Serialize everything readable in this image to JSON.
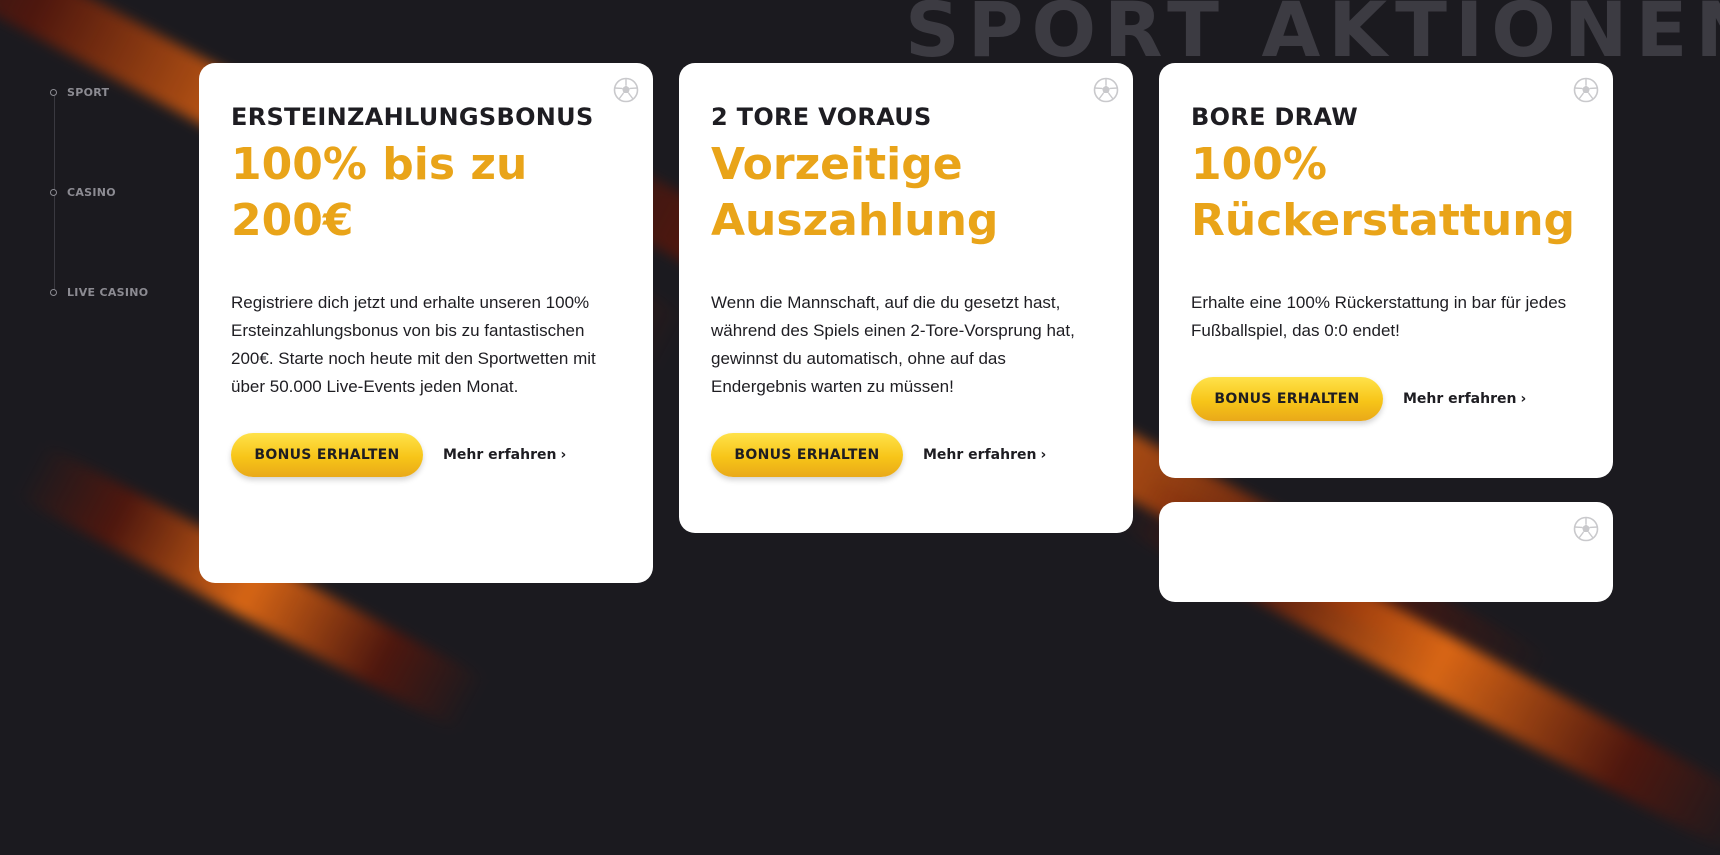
{
  "section_title": "SPORT AKTIONEN",
  "side_nav": {
    "items": [
      {
        "label": "SPORT"
      },
      {
        "label": "CASINO"
      },
      {
        "label": "LIVE CASINO"
      }
    ]
  },
  "cards": [
    {
      "kicker": "ERSTEINZAHLUNGSBONUS",
      "headline_line1": "100% bis zu",
      "headline_line2": "200€",
      "text": "Registriere dich jetzt und erhalte unseren 100% Ersteinzahlungsbonus von bis zu fantastischen 200€. Starte noch heute mit den Sportwetten mit über 50.000 Live-Events jeden Monat.",
      "button_label": "BONUS ERHALTEN",
      "link_label": "Mehr erfahren"
    },
    {
      "kicker": "2 TORE VORAUS",
      "headline_line1": "Vorzeitige",
      "headline_line2": "Auszahlung",
      "text": "Wenn die Mannschaft, auf die du gesetzt hast, während des Spiels einen 2-Tore-Vorsprung hat, gewinnst du automatisch, ohne auf das Endergebnis warten zu müssen!",
      "button_label": "BONUS ERHALTEN",
      "link_label": "Mehr erfahren"
    },
    {
      "kicker": "BORE DRAW",
      "headline_line1": "100%",
      "headline_line2": "Rückerstattung",
      "text": "Erhalte eine 100% Rückerstattung in bar für jedes Fußballspiel, das 0:0 endet!",
      "button_label": "BONUS ERHALTEN",
      "link_label": "Mehr erfahren"
    }
  ],
  "icons": {
    "card_icon": "soccer-ball-icon",
    "link_icon": "chevron-right-icon"
  },
  "colors": {
    "background": "#1b1a1f",
    "accent": "#e9a419",
    "button_yellow": "#f7c518",
    "card": "#ffffff",
    "title_ghost": "#3c3b42"
  }
}
